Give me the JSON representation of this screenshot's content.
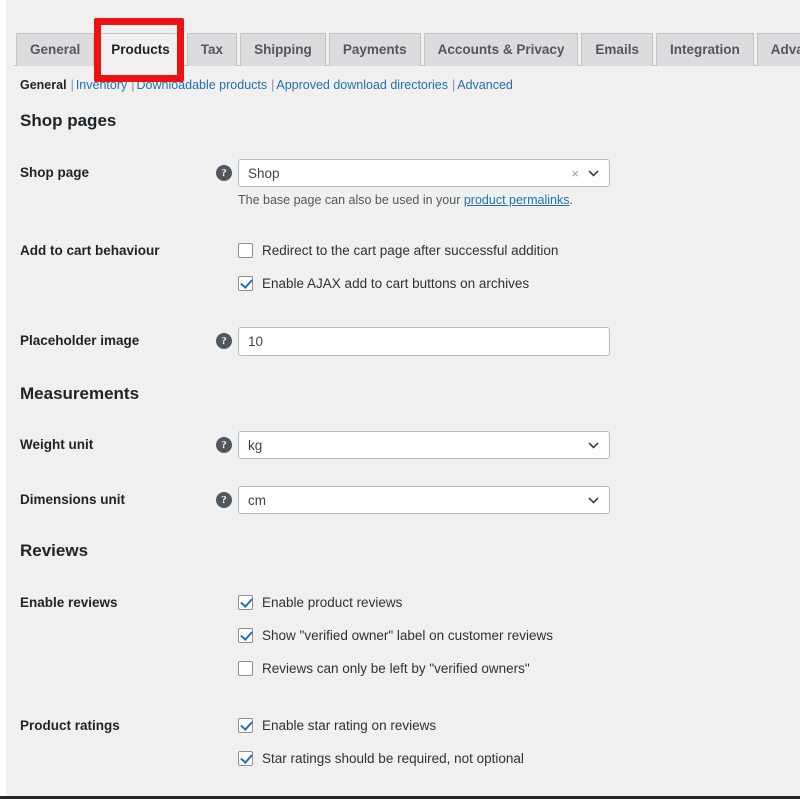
{
  "tabs": [
    {
      "label": "General",
      "active": false
    },
    {
      "label": "Products",
      "active": true
    },
    {
      "label": "Tax",
      "active": false
    },
    {
      "label": "Shipping",
      "active": false
    },
    {
      "label": "Payments",
      "active": false
    },
    {
      "label": "Accounts & Privacy",
      "active": false
    },
    {
      "label": "Emails",
      "active": false
    },
    {
      "label": "Integration",
      "active": false
    },
    {
      "label": "Advanced",
      "active": false
    }
  ],
  "subnav": {
    "current": "General",
    "links": [
      "Inventory",
      "Downloadable products",
      "Approved download directories",
      "Advanced"
    ],
    "separator": "|"
  },
  "sections": {
    "shop_pages": {
      "title": "Shop pages",
      "shop_page": {
        "label": "Shop page",
        "help_icon": "help-icon",
        "value": "Shop",
        "clear_icon": "×",
        "hint_before": "The base page can also be used in your ",
        "hint_link": "product permalinks",
        "hint_after": "."
      },
      "add_to_cart": {
        "label": "Add to cart behaviour",
        "options": [
          {
            "label": "Redirect to the cart page after successful addition",
            "checked": false
          },
          {
            "label": "Enable AJAX add to cart buttons on archives",
            "checked": true
          }
        ]
      },
      "placeholder_image": {
        "label": "Placeholder image",
        "help_icon": "help-icon",
        "value": "10"
      }
    },
    "measurements": {
      "title": "Measurements",
      "weight_unit": {
        "label": "Weight unit",
        "help_icon": "help-icon",
        "value": "kg"
      },
      "dimensions_unit": {
        "label": "Dimensions unit",
        "help_icon": "help-icon",
        "value": "cm"
      }
    },
    "reviews": {
      "title": "Reviews",
      "enable_reviews": {
        "label": "Enable reviews",
        "options": [
          {
            "label": "Enable product reviews",
            "checked": true
          },
          {
            "label": "Show \"verified owner\" label on customer reviews",
            "checked": true
          },
          {
            "label": "Reviews can only be left by \"verified owners\"",
            "checked": false
          }
        ]
      },
      "product_ratings": {
        "label": "Product ratings",
        "options": [
          {
            "label": "Enable star rating on reviews",
            "checked": true
          },
          {
            "label": "Star ratings should be required, not optional",
            "checked": true
          }
        ]
      }
    }
  },
  "colors": {
    "accent": "#2271b1",
    "annotation": "#ee1111",
    "background": "#f0f0f1",
    "tab_inactive": "#dcdcde"
  }
}
